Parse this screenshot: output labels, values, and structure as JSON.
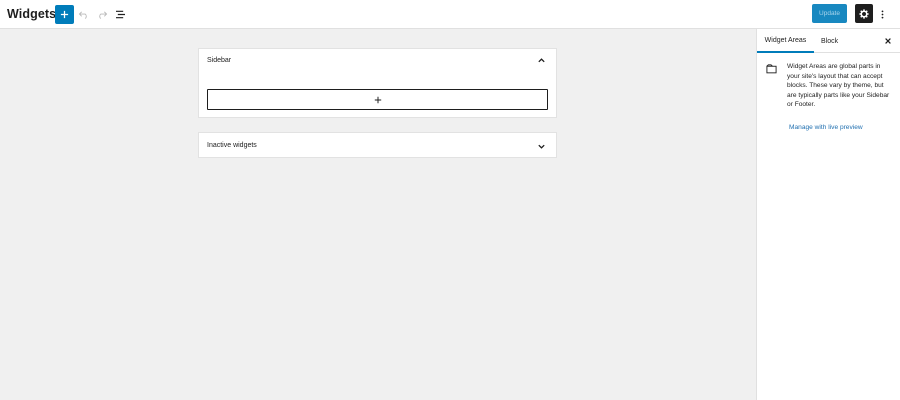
{
  "header": {
    "title": "Widgets",
    "add_icon": "plus-icon",
    "undo_icon": "undo-icon",
    "redo_icon": "redo-icon",
    "list_view_icon": "list-view-icon",
    "update_label": "Update",
    "settings_icon": "gear-icon",
    "more_icon": "more-vertical-icon"
  },
  "widget_areas": [
    {
      "label": "Sidebar",
      "expanded": true,
      "appender_icon": "plus-icon"
    },
    {
      "label": "Inactive widgets",
      "expanded": false
    }
  ],
  "sidebar_panel": {
    "tabs": [
      {
        "label": "Widget Areas",
        "active": true
      },
      {
        "label": "Block",
        "active": false
      }
    ],
    "close_icon": "close-icon",
    "icon": "widget-area-icon",
    "description": "Widget Areas are global parts in your site's layout that can accept blocks. These vary by theme, but are typically parts like your Sidebar or Footer.",
    "link": "Manage with live preview"
  },
  "colors": {
    "accent": "#007cba",
    "dark": "#1e1e1e",
    "canvas": "#f0f0f0"
  }
}
